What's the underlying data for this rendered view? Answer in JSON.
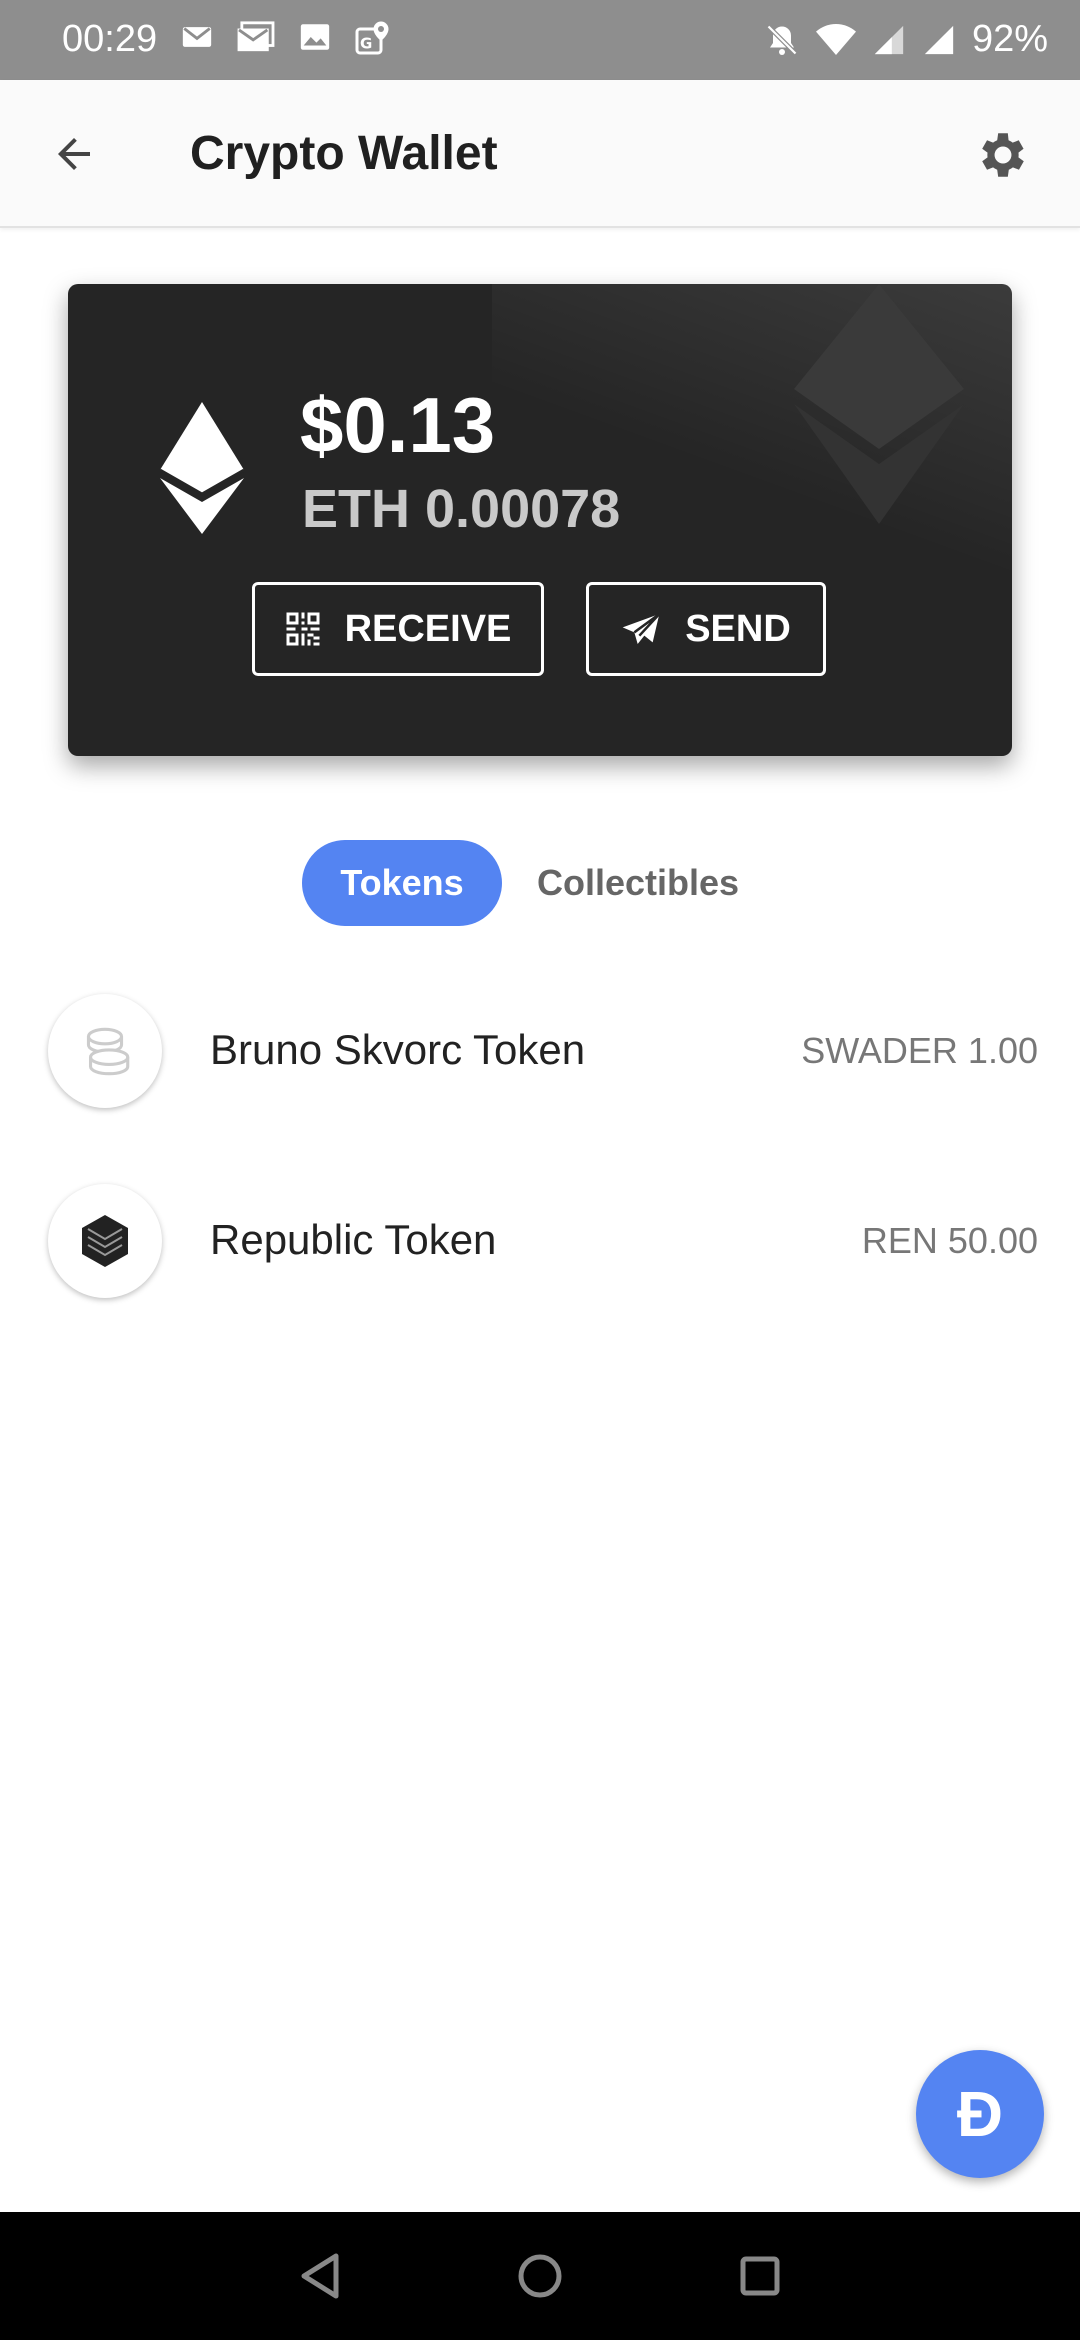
{
  "status_bar": {
    "time": "00:29",
    "battery": "92%",
    "left_icons": [
      "mail-icon",
      "gmail-icon",
      "image-icon",
      "maps-icon"
    ],
    "right_icons": [
      "dnd-off-icon",
      "wifi-icon",
      "signal-icon",
      "signal-icon"
    ]
  },
  "app_bar": {
    "title": "Crypto Wallet",
    "back_icon": "arrow-left-icon",
    "settings_icon": "gear-icon"
  },
  "wallet_card": {
    "balance_usd": "$0.13",
    "balance_eth": "ETH 0.00078",
    "receive_label": "RECEIVE",
    "send_label": "SEND",
    "colors": {
      "card": "#252525",
      "text": "#ffffff",
      "secondary": "#c9c9c9"
    }
  },
  "tabs": [
    {
      "label": "Tokens",
      "selected": true
    },
    {
      "label": "Collectibles",
      "selected": false
    }
  ],
  "tokens": [
    {
      "name": "Bruno Skvorc Token",
      "balance": "SWADER 1.00",
      "icon": "coins-icon"
    },
    {
      "name": "Republic Token",
      "balance": "REN 50.00",
      "icon": "republic-logo-icon"
    }
  ],
  "fab": {
    "label": "Đ"
  },
  "colors": {
    "accent": "#5484f2",
    "status_bar": "#8e8e8e",
    "nav_bar": "#000000"
  }
}
